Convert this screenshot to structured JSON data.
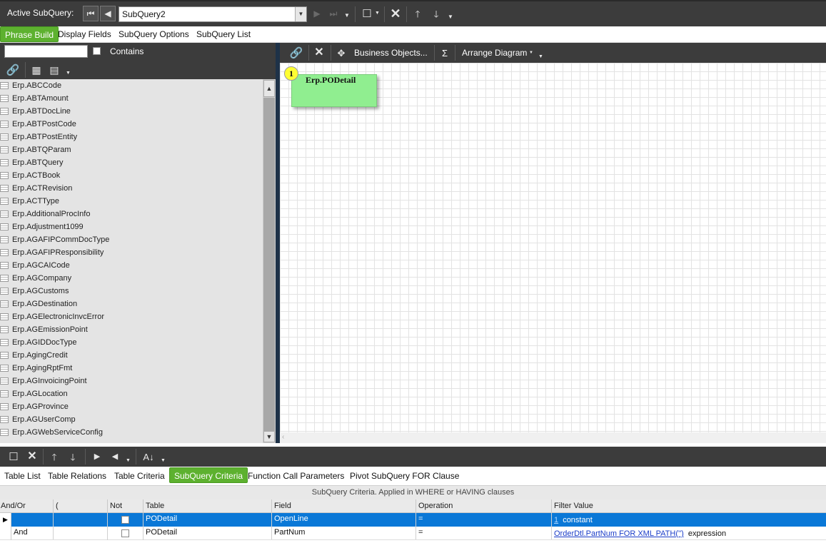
{
  "toolbar": {
    "active_label": "Active SubQuery:",
    "subquery_value": "SubQuery2"
  },
  "top_tabs": [
    "Phrase Build",
    "Display Fields",
    "SubQuery Options",
    "SubQuery List"
  ],
  "filter": {
    "value": "",
    "contains_label": "Contains"
  },
  "tables": [
    "Erp.ABCCode",
    "Erp.ABTAmount",
    "Erp.ABTDocLine",
    "Erp.ABTPostCode",
    "Erp.ABTPostEntity",
    "Erp.ABTQParam",
    "Erp.ABTQuery",
    "Erp.ACTBook",
    "Erp.ACTRevision",
    "Erp.ACTType",
    "Erp.AdditionalProcInfo",
    "Erp.Adjustment1099",
    "Erp.AGAFIPCommDocType",
    "Erp.AGAFIPResponsibility",
    "Erp.AGCAICode",
    "Erp.AGCompany",
    "Erp.AGCustoms",
    "Erp.AGDestination",
    "Erp.AGElectronicInvcError",
    "Erp.AGEmissionPoint",
    "Erp.AGIDDocType",
    "Erp.AgingCredit",
    "Erp.AgingRptFmt",
    "Erp.AGInvoicingPoint",
    "Erp.AGLocation",
    "Erp.AGProvince",
    "Erp.AGUserComp",
    "Erp.AGWebServiceConfig"
  ],
  "diagram_toolbar": {
    "business_objects": "Business Objects...",
    "sigma": "Σ",
    "arrange": "Arrange Diagram"
  },
  "diagram": {
    "node_number": "1",
    "node_label": "Erp.PODetail"
  },
  "bottom_tabs": [
    "Table List",
    "Table Relations",
    "Table Criteria",
    "SubQuery Criteria",
    "Function Call Parameters",
    "Pivot SubQuery FOR Clause"
  ],
  "criteria": {
    "caption": "SubQuery Criteria. Applied in WHERE or HAVING clauses",
    "columns": [
      "And/Or",
      "(",
      "Not",
      "Table",
      "Field",
      "Operation",
      "Filter Value"
    ],
    "rows": [
      {
        "andor": "",
        "paren": "",
        "table": "PODetail",
        "field": "OpenLine",
        "op": "=",
        "value_link": "1",
        "value_text": "constant"
      },
      {
        "andor": "And",
        "paren": "",
        "table": "PODetail",
        "field": "PartNum",
        "op": "=",
        "value_link": "OrderDtl.PartNum FOR XML PATH('')",
        "value_text": "expression"
      }
    ]
  },
  "colors": {
    "toolbar": "#3c3c3c",
    "accent": "#5db12f",
    "node": "#90ee90",
    "selection": "#0a78d7"
  }
}
